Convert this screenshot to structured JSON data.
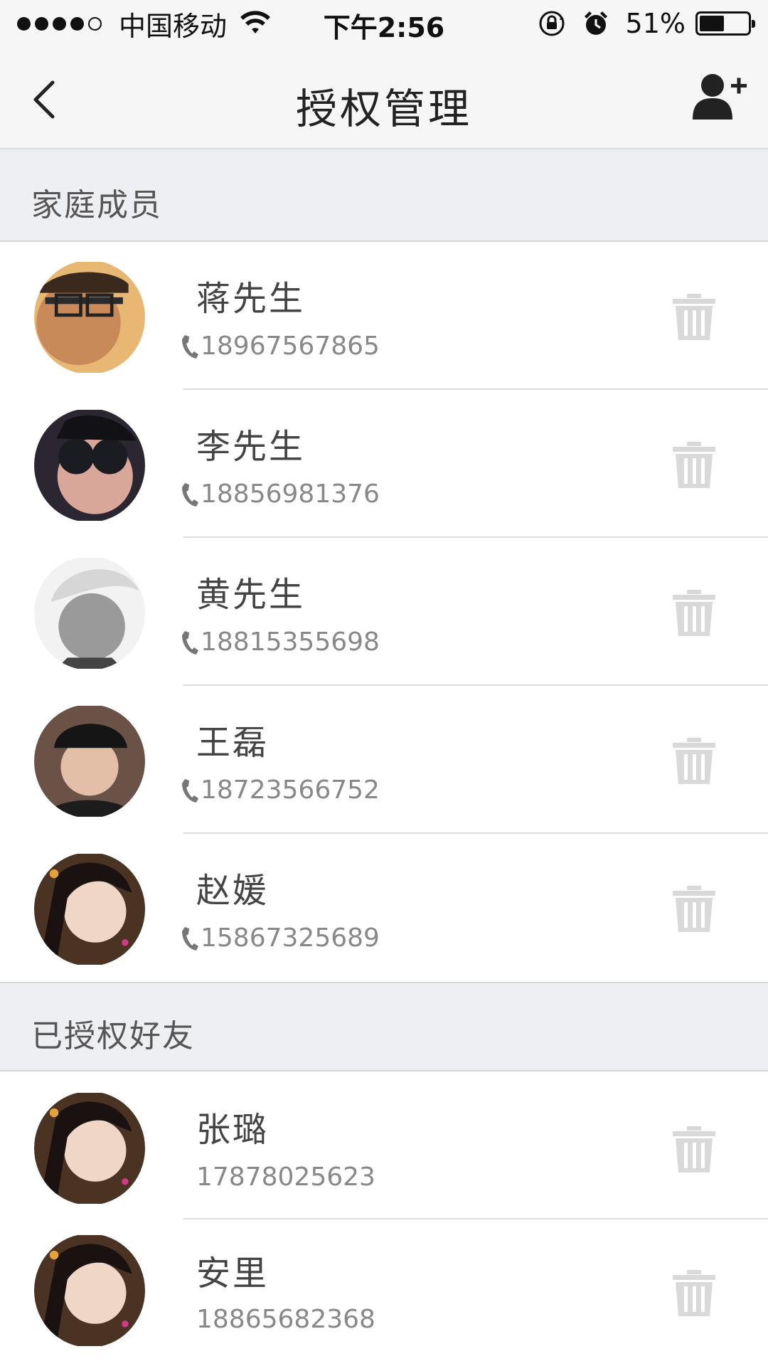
{
  "status_bar": {
    "carrier": "中国移动",
    "time": "下午2:56",
    "battery": "51%",
    "battery_level": 0.51
  },
  "nav": {
    "title": "授权管理",
    "back_icon": "chevron-left-icon",
    "add_icon": "add-user-icon"
  },
  "sections": [
    {
      "label": "家庭成员",
      "members": [
        {
          "name": "蒋先生",
          "phone": "18967567865",
          "show_phone_icon": true
        },
        {
          "name": "李先生",
          "phone": "18856981376",
          "show_phone_icon": true
        },
        {
          "name": "黄先生",
          "phone": "18815355698",
          "show_phone_icon": true
        },
        {
          "name": "王磊",
          "phone": "18723566752",
          "show_phone_icon": true
        },
        {
          "name": "赵媛",
          "phone": "15867325689",
          "show_phone_icon": true
        }
      ]
    },
    {
      "label": "已授权好友",
      "members": [
        {
          "name": "张璐",
          "phone": "17878025623",
          "show_phone_icon": false
        },
        {
          "name": "安里",
          "phone": "18865682368",
          "show_phone_icon": false
        }
      ]
    }
  ],
  "colors": {
    "background": "#f3f3f3",
    "section_bg": "#eeeff3",
    "trash": "#d9d9d9",
    "phone_text": "#888888"
  }
}
